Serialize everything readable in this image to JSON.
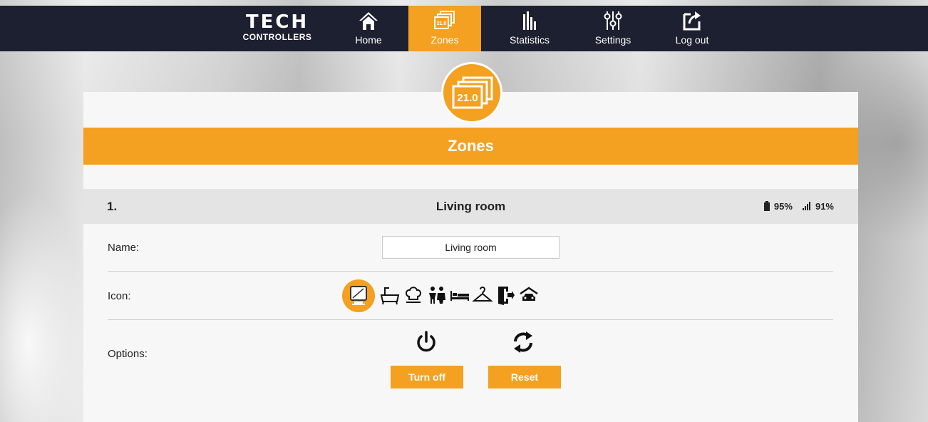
{
  "brand": {
    "line1": "TECH",
    "line2": "CONTROLLERS"
  },
  "nav": [
    {
      "label": "Home",
      "icon": "home-icon"
    },
    {
      "label": "Zones",
      "icon": "zones-icon",
      "active": true,
      "badge": "21.0"
    },
    {
      "label": "Statistics",
      "icon": "statistics-icon"
    },
    {
      "label": "Settings",
      "icon": "settings-sliders-icon"
    },
    {
      "label": "Log out",
      "icon": "logout-icon"
    }
  ],
  "page": {
    "title": "Zones",
    "badge": "21.0"
  },
  "zone": {
    "number": "1.",
    "name": "Living room",
    "battery": "95%",
    "signal": "91%"
  },
  "form": {
    "name_label": "Name:",
    "name_value": "Living room",
    "icon_label": "Icon:",
    "icons": [
      "tv-icon",
      "bathtub-icon",
      "chef-hat-icon",
      "children-icon",
      "bed-icon",
      "hanger-icon",
      "door-exit-icon",
      "garage-car-icon"
    ],
    "selected_icon": "tv-icon",
    "options_label": "Options:",
    "turn_off_label": "Turn off",
    "reset_label": "Reset"
  },
  "colors": {
    "accent": "#f4a021",
    "nav_bg": "#1d2030"
  }
}
